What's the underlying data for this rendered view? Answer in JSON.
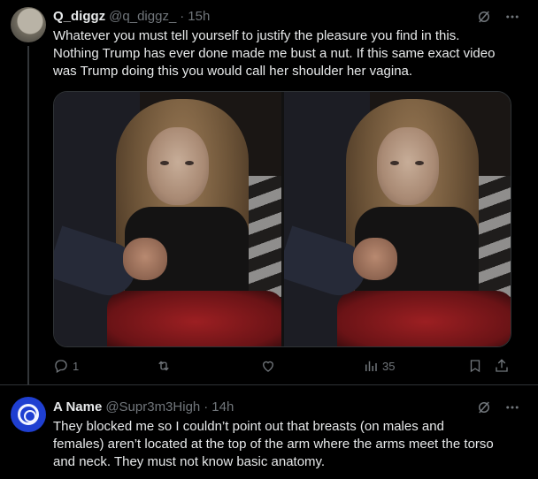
{
  "tweets": [
    {
      "display_name": "Q_diggz",
      "handle": "@q_diggz_",
      "separator": "·",
      "time": "15h",
      "text_lines": [
        "Whatever you must tell yourself to justify the pleasure you find in this.",
        "Nothing Trump has ever done made me bust a nut. If this same exact video",
        "was Trump doing this you would call her shoulder her vagina."
      ],
      "stats": {
        "replies": "1",
        "retweets": "",
        "likes": "",
        "views": "35"
      },
      "icons": {
        "avatar": "user-avatar-photo",
        "grok": "grok-slash-icon",
        "more": "more-dots-icon"
      },
      "media_count": 2
    },
    {
      "display_name": "A Name",
      "handle": "@Supr3m3High",
      "separator": "·",
      "time": "14h",
      "text_lines": [
        "They blocked me so I couldn’t point out that breasts (on males and",
        "females) aren’t located at the top of the arm where the arms meet the torso",
        "and neck. They must not know basic anatomy."
      ],
      "icons": {
        "avatar": "green-lantern-logo-avatar",
        "grok": "grok-slash-icon",
        "more": "more-dots-icon"
      }
    }
  ],
  "colors": {
    "background": "#000000",
    "text": "#e7e9ea",
    "muted": "#71767b",
    "border": "#2f3336",
    "avatar2": "#1f3fd1"
  }
}
